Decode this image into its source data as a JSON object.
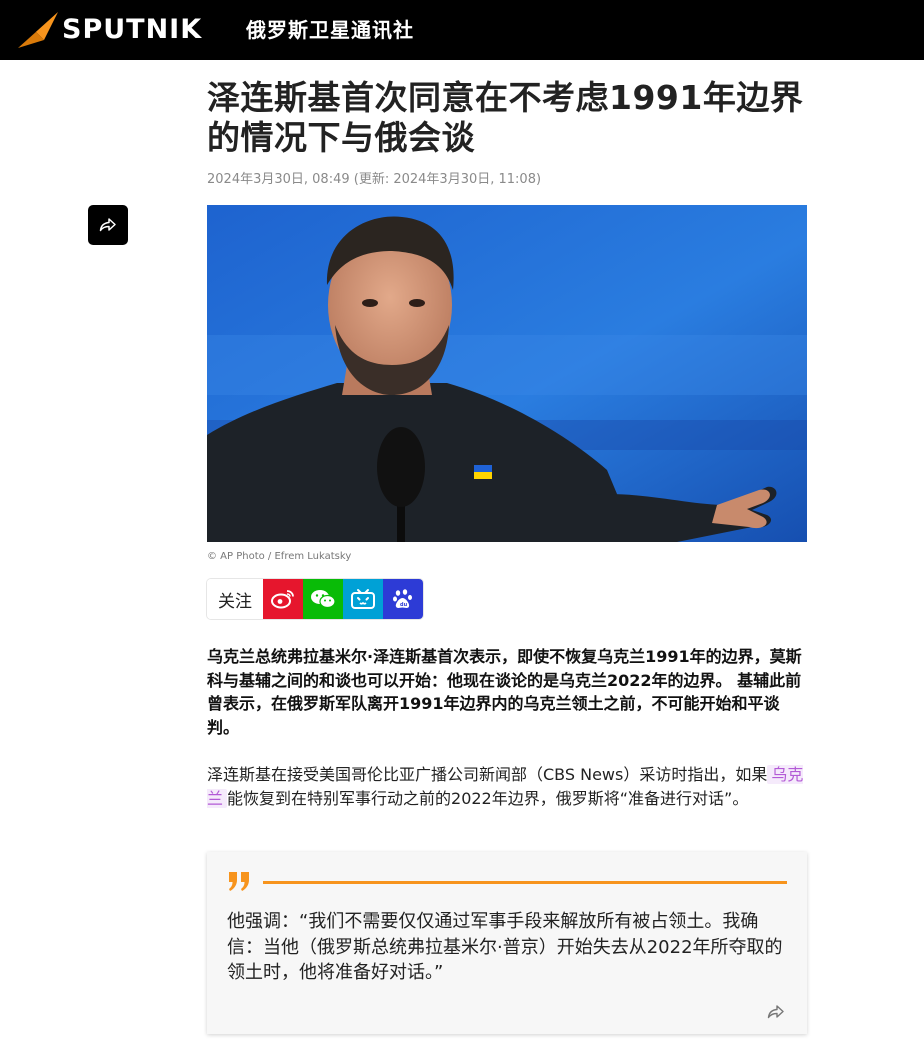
{
  "header": {
    "brand_word": "SPUTNIK",
    "brand_cn": "俄罗斯卫星通讯社",
    "brand_accent": "#f7941d"
  },
  "article": {
    "title": "泽连斯基首次同意在不考虑1991年边界的情况下与俄会谈",
    "date": "2024年3月30日, 08:49 (更新: 2024年3月30日, 11:08)",
    "image_credit": "© AP Photo / Efrem Lukatsky",
    "lead": "乌克兰总统弗拉基米尔·泽连斯基首次表示，即使不恢复乌克兰1991年的边界，莫斯科与基辅之间的和谈也可以开始：他现在谈论的是乌克兰2022年的边界。 基辅此前曾表示，在俄罗斯军队离开1991年边界内的乌克兰领土之前，不可能开始和平谈判。",
    "para_before": "泽连斯基在接受美国哥伦比亚广播公司新闻部（CBS News）采访时指出，如果",
    "para_tag": "乌克兰",
    "para_after": "能恢复到在特别军事行动之前的2022年边界，俄罗斯将“准备进行对话”。",
    "quote": "他强调：“我们不需要仅仅通过军事手段来解放所有被占领土。我确信：当他（俄罗斯总统弗拉基米尔·普京）开始失去从2022年所夺取的领土时，他将准备好对话。”"
  },
  "follow": {
    "label": "关注",
    "buttons": [
      {
        "icon": "weibo-icon",
        "color": "#e6162d"
      },
      {
        "icon": "wechat-icon",
        "color": "#09bb07"
      },
      {
        "icon": "bilibili-icon",
        "color": "#00a1d6"
      },
      {
        "icon": "baidu-icon",
        "color": "#2d3bd6"
      }
    ]
  }
}
